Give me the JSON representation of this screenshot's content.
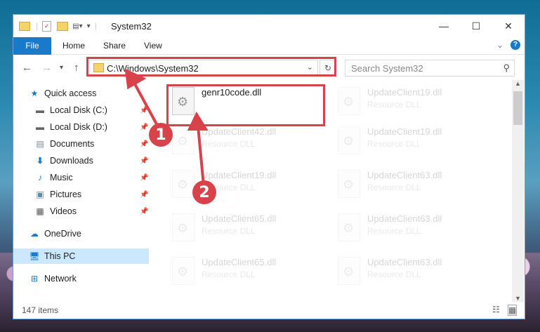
{
  "window": {
    "title": "System32"
  },
  "ribbon": {
    "tabs": [
      "File",
      "Home",
      "Share",
      "View"
    ]
  },
  "address": {
    "path": "C:\\Windows\\System32"
  },
  "search": {
    "placeholder": "Search System32"
  },
  "sidebar": {
    "items": [
      {
        "label": "Quick access",
        "icon": "star-icon"
      },
      {
        "label": "Local Disk (C:)",
        "icon": "drive-icon",
        "pinned": true
      },
      {
        "label": "Local Disk (D:)",
        "icon": "drive-icon",
        "pinned": true
      },
      {
        "label": "Documents",
        "icon": "documents-icon",
        "pinned": true
      },
      {
        "label": "Downloads",
        "icon": "downloads-icon",
        "pinned": true
      },
      {
        "label": "Music",
        "icon": "music-icon",
        "pinned": true
      },
      {
        "label": "Pictures",
        "icon": "pictures-icon",
        "pinned": true
      },
      {
        "label": "Videos",
        "icon": "videos-icon",
        "pinned": true
      },
      {
        "label": "OneDrive",
        "icon": "cloud-icon"
      },
      {
        "label": "This PC",
        "icon": "computer-icon",
        "selected": true
      },
      {
        "label": "Network",
        "icon": "network-icon"
      }
    ]
  },
  "files": {
    "highlighted": {
      "name": "genr10code.dll"
    },
    "faded": [
      {
        "name": "UpdateClient19.dll",
        "type": "Resource DLL"
      },
      {
        "name": "UpdateClient42.dll",
        "type": "Resource DLL"
      },
      {
        "name": "UpdateClient19.dll",
        "type": "Resource DLL"
      },
      {
        "name": "UpdateClient19.dll",
        "type": "Resource DLL"
      },
      {
        "name": "UpdateClient63.dll",
        "type": "Resource DLL"
      },
      {
        "name": "UpdateClient65.dll",
        "type": "Resource DLL"
      },
      {
        "name": "UpdateClient63.dll",
        "type": "Resource DLL"
      },
      {
        "name": "UpdateClient65.dll",
        "type": "Resource DLL"
      },
      {
        "name": "UpdateClient63.dll",
        "type": "Resource DLL"
      }
    ]
  },
  "status": {
    "items": "147 items"
  },
  "callouts": [
    "1",
    "2"
  ],
  "colors": {
    "accent": "#1979ca",
    "highlight": "#d8424a",
    "selected": "#cce8ff"
  }
}
